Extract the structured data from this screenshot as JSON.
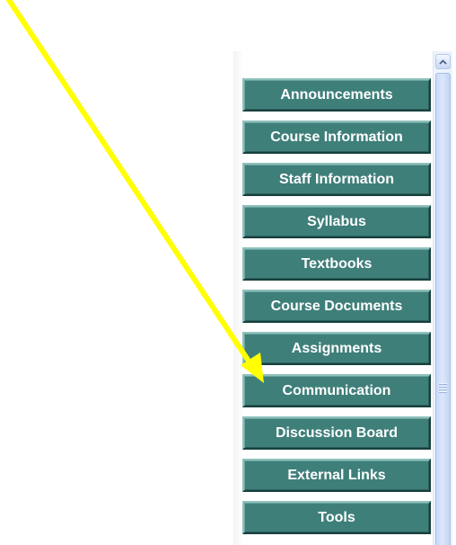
{
  "course_menu": {
    "items": [
      {
        "label": "Announcements"
      },
      {
        "label": "Course Information"
      },
      {
        "label": "Staff Information"
      },
      {
        "label": "Syllabus"
      },
      {
        "label": "Textbooks"
      },
      {
        "label": "Course Documents"
      },
      {
        "label": "Assignments"
      },
      {
        "label": "Communication"
      },
      {
        "label": "Discussion Board"
      },
      {
        "label": "External Links"
      },
      {
        "label": "Tools"
      }
    ],
    "button_color": "#3f7f7a",
    "button_text_color": "#ffffff"
  },
  "scrollbar": {
    "up_icon": "chevron-up-icon",
    "thumb_icon": "grip-icon"
  },
  "annotation": {
    "icon": "arrow-icon",
    "color": "#ffff00",
    "points_to": "Communication"
  }
}
